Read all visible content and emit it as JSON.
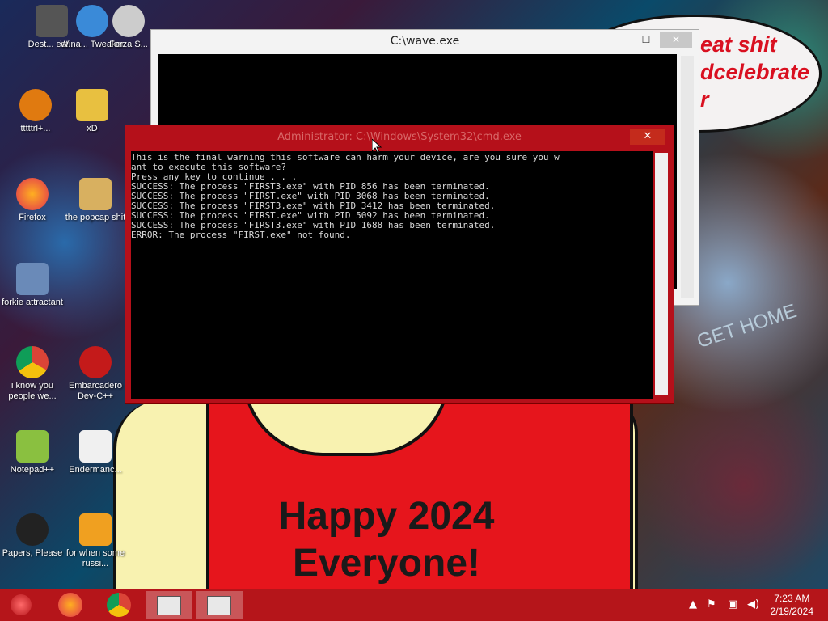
{
  "speech_bubble": {
    "text": "eat shit\ndcelebrate\nr"
  },
  "wallpaper": {
    "banner": "Happy 2024\nEveryone!",
    "get_home": "GET HOME"
  },
  "desktop_icons": [
    {
      "label": "Dest... est..."
    },
    {
      "label": "Wina... Tweaker"
    },
    {
      "label": "Forza S..."
    },
    {
      "label": "tttttrl+..."
    },
    {
      "label": "xD"
    },
    {
      "label": "Firefox"
    },
    {
      "label": "the popcap shit"
    },
    {
      "label": "forkie attractant"
    },
    {
      "label": "i know you people we..."
    },
    {
      "label": "Embarcadero Dev-C++"
    },
    {
      "label": "Notepad++"
    },
    {
      "label": "Endermanc..."
    },
    {
      "label": "Papers, Please"
    },
    {
      "label": "for when some russi..."
    }
  ],
  "wave_window": {
    "title": "C:\\wave.exe",
    "minimize": "—",
    "maximize": "☐",
    "close": "✕"
  },
  "cmd_window": {
    "title": "Administrator: C:\\Windows\\System32\\cmd.exe",
    "close": "✕",
    "lines": [
      "This is the final warning this software can harm your device, are you sure you w",
      "ant to execute this software?",
      "Press any key to continue . . .",
      "SUCCESS: The process \"FIRST3.exe\" with PID 856 has been terminated.",
      "SUCCESS: The process \"FIRST.exe\" with PID 3068 has been terminated.",
      "SUCCESS: The process \"FIRST3.exe\" with PID 3412 has been terminated.",
      "SUCCESS: The process \"FIRST.exe\" with PID 5092 has been terminated.",
      "SUCCESS: The process \"FIRST3.exe\" with PID 1688 has been terminated.",
      "ERROR: The process \"FIRST.exe\" not found."
    ]
  },
  "taskbar": {
    "time": "7:23 AM",
    "date": "2/19/2024"
  },
  "colors": {
    "taskbar": "#b5151a",
    "cmd_frame": "#b5101a",
    "speech_text": "#d91020"
  }
}
